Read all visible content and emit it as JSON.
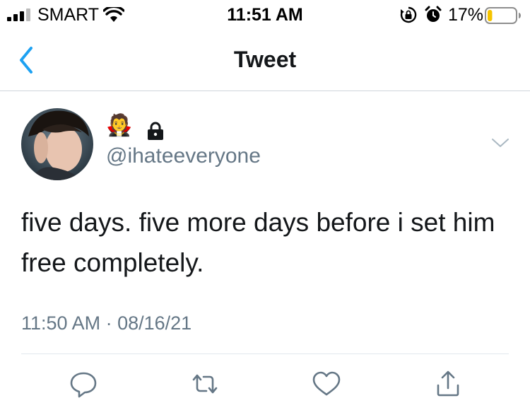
{
  "status_bar": {
    "carrier": "SMART",
    "time": "11:51 AM",
    "battery_percent": "17%",
    "battery_level": 0.17,
    "icons": [
      "signal-icon",
      "wifi-icon",
      "orientation-lock-icon",
      "alarm-icon",
      "battery-icon"
    ]
  },
  "nav": {
    "title": "Tweet",
    "back_icon": "chevron-left-icon"
  },
  "tweet": {
    "display_name_emoji": "🧛",
    "protected_icon": "lock-icon",
    "username": "@ihateeveryone",
    "text": "five days. five more days before i set him free completely.",
    "timestamp": "11:50 AM · 08/16/21",
    "menu_icon": "chevron-down-icon"
  },
  "actions": [
    {
      "name": "reply",
      "icon": "reply-icon"
    },
    {
      "name": "retweet",
      "icon": "retweet-icon"
    },
    {
      "name": "like",
      "icon": "heart-icon"
    },
    {
      "name": "share",
      "icon": "share-icon"
    }
  ],
  "colors": {
    "accent": "#1da1f2",
    "text": "#14171a",
    "secondary": "#657786",
    "battery_low": "#f5c400"
  }
}
